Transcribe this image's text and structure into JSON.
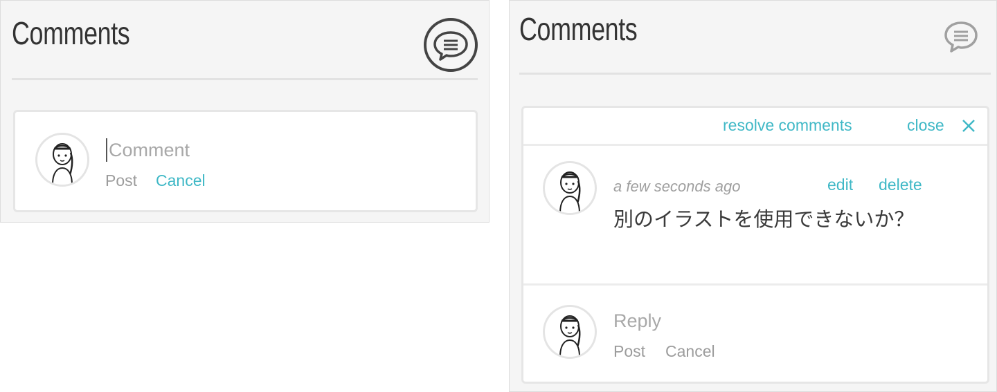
{
  "left_panel": {
    "title": "Comments",
    "toggle_icon": "speech-bubble-icon",
    "new_comment": {
      "placeholder": "Comment",
      "post_label": "Post",
      "cancel_label": "Cancel"
    }
  },
  "right_panel": {
    "title": "Comments",
    "toggle_icon": "speech-bubble-icon",
    "toolbar": {
      "resolve_label": "resolve comments",
      "close_label": "close",
      "close_icon": "close-x-icon"
    },
    "thread": {
      "timestamp": "a few seconds ago",
      "edit_label": "edit",
      "delete_label": "delete",
      "body": "別のイラストを使用できないか？"
    },
    "reply": {
      "placeholder": "Reply",
      "post_label": "Post",
      "cancel_label": "Cancel"
    }
  },
  "colors": {
    "accent": "#3fb8c6",
    "panel_bg": "#f5f5f5",
    "muted_text": "#9c9c9c"
  }
}
